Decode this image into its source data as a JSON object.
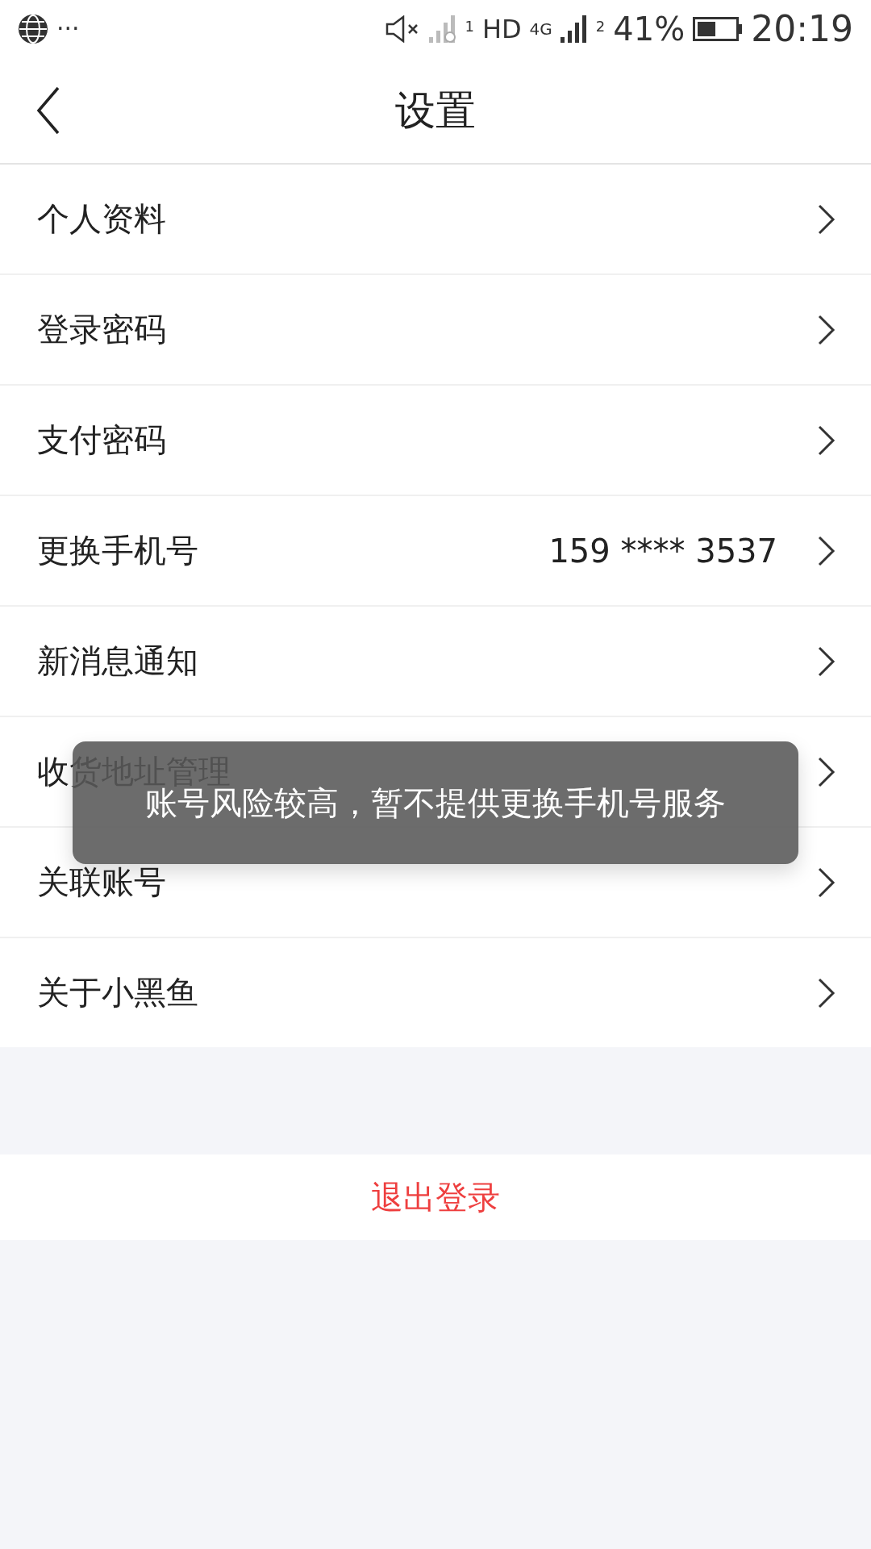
{
  "status_bar": {
    "ellipsis": "···",
    "sim1": "1",
    "hd": "HD",
    "network": "4G",
    "sim2": "2",
    "battery": "41%",
    "time": "20:19"
  },
  "header": {
    "title": "设置"
  },
  "menu": [
    {
      "label": "个人资料"
    },
    {
      "label": "登录密码"
    },
    {
      "label": "支付密码"
    },
    {
      "label": "更换手机号",
      "value": "159 **** 3537"
    },
    {
      "label": "新消息通知"
    },
    {
      "label": "收货地址管理"
    },
    {
      "label": "关联账号"
    },
    {
      "label": "关于小黑鱼"
    }
  ],
  "logout": "退出登录",
  "toast": "账号风险较高，暂不提供更换手机号服务"
}
